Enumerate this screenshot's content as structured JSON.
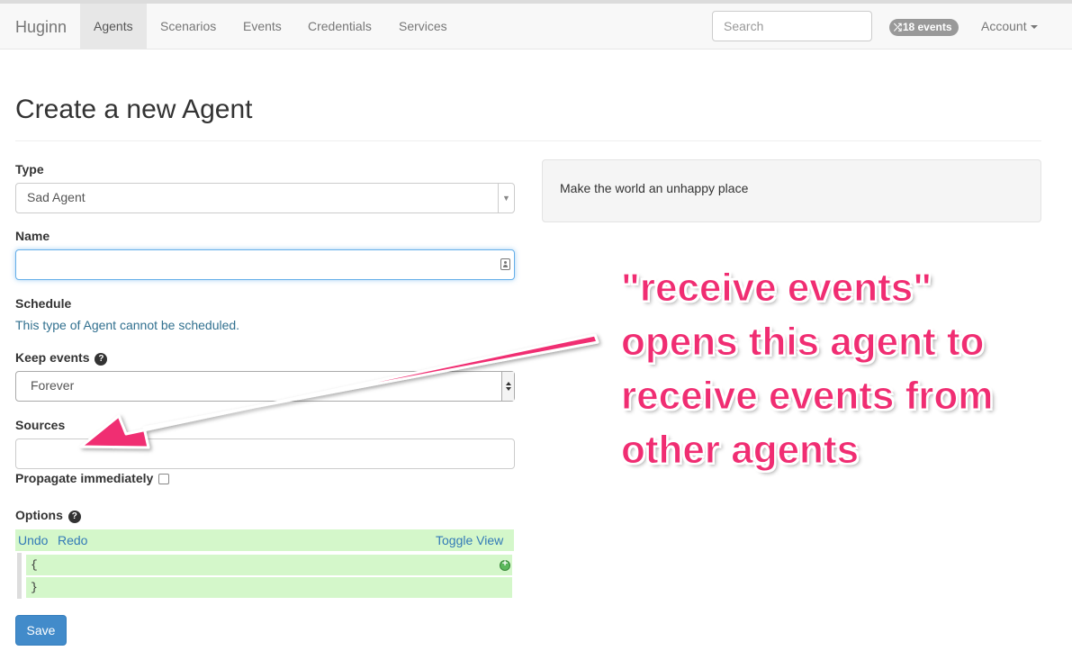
{
  "navbar": {
    "brand": "Huginn",
    "items": [
      {
        "label": "Agents",
        "active": true
      },
      {
        "label": "Scenarios",
        "active": false
      },
      {
        "label": "Events",
        "active": false
      },
      {
        "label": "Credentials",
        "active": false
      },
      {
        "label": "Services",
        "active": false
      }
    ],
    "search_placeholder": "Search",
    "events_badge": "18 events",
    "account_label": "Account"
  },
  "page": {
    "title": "Create a new Agent"
  },
  "form": {
    "type_label": "Type",
    "type_value": "Sad Agent",
    "name_label": "Name",
    "name_value": "",
    "schedule_label": "Schedule",
    "schedule_text": "This type of Agent cannot be scheduled.",
    "keep_events_label": "Keep events",
    "keep_events_value": "Forever",
    "sources_label": "Sources",
    "propagate_label": "Propagate immediately",
    "propagate_checked": false,
    "options_label": "Options",
    "editor": {
      "undo": "Undo",
      "redo": "Redo",
      "toggle_view": "Toggle View",
      "lines": [
        "{",
        "}"
      ]
    },
    "save_label": "Save"
  },
  "description": "Make the world an unhappy place",
  "annotation": {
    "lines": [
      "\"receive events\"",
      "opens this agent to",
      "receive events from",
      "other agents"
    ],
    "color": "#f02d72"
  },
  "colors": {
    "link": "#337ab7",
    "primary": "#428bca",
    "editor_bg": "#d4f7ca",
    "info_text": "#31708f"
  }
}
